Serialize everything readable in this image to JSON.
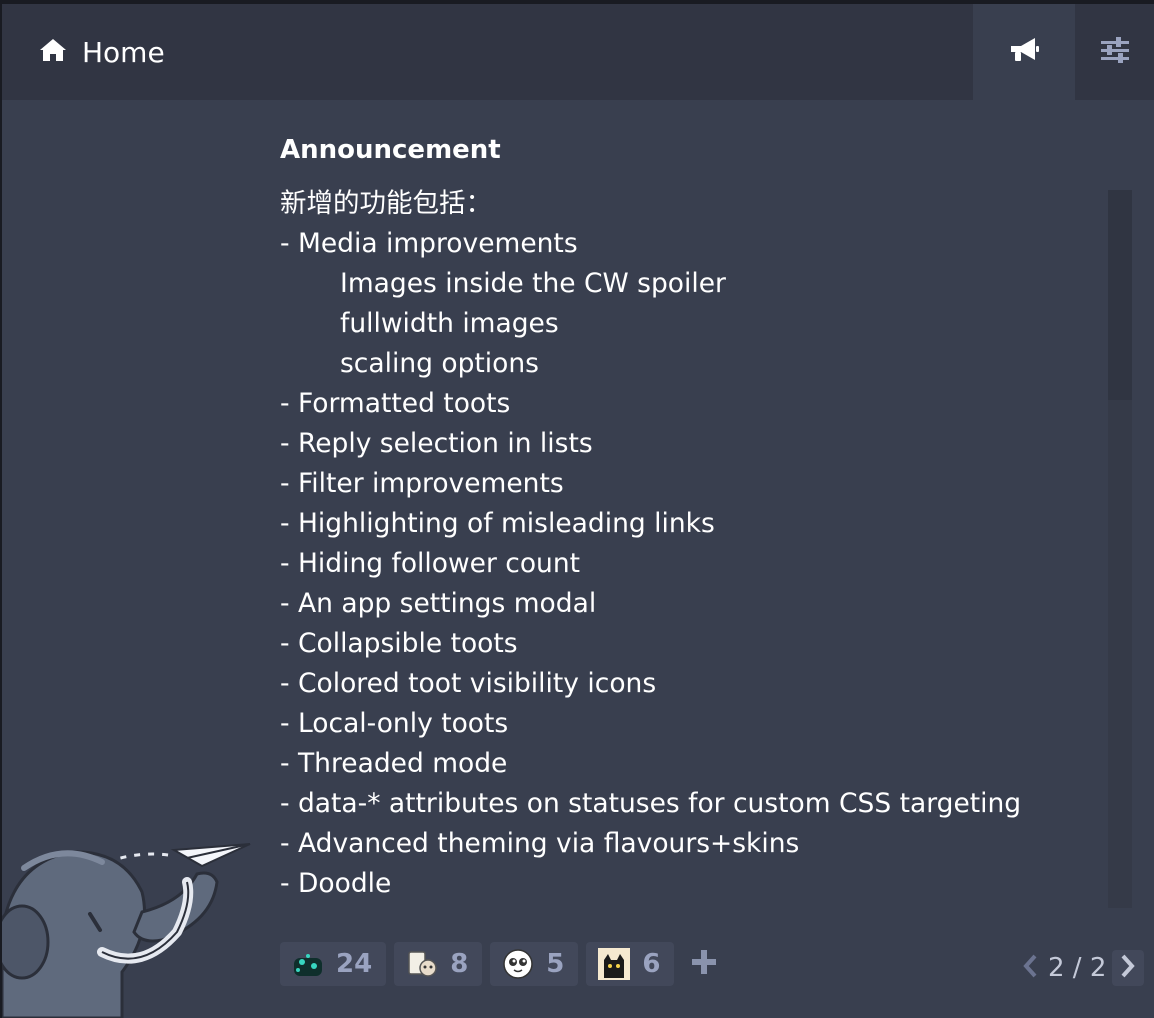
{
  "header": {
    "title": "Home",
    "icons": {
      "home": "home-icon",
      "announcements": "bullhorn-icon",
      "settings": "sliders-icon"
    }
  },
  "announcement": {
    "title": "Announcement",
    "lines": [
      {
        "text": "新增的功能包括：",
        "indent": false
      },
      {
        "text": "- Media improvements",
        "indent": false
      },
      {
        "text": "Images inside the CW spoiler",
        "indent": true
      },
      {
        "text": "fullwidth images",
        "indent": true
      },
      {
        "text": "scaling options",
        "indent": true
      },
      {
        "text": "- Formatted toots",
        "indent": false
      },
      {
        "text": "- Reply selection in lists",
        "indent": false
      },
      {
        "text": "- Filter improvements",
        "indent": false
      },
      {
        "text": "- Highlighting of misleading links",
        "indent": false
      },
      {
        "text": "- Hiding follower count",
        "indent": false
      },
      {
        "text": "- An app settings modal",
        "indent": false
      },
      {
        "text": "- Collapsible toots",
        "indent": false
      },
      {
        "text": "- Colored toot visibility icons",
        "indent": false
      },
      {
        "text": "- Local-only toots",
        "indent": false
      },
      {
        "text": "- Threaded mode",
        "indent": false
      },
      {
        "text": "- data-* attributes on statuses for custom CSS targeting",
        "indent": false
      },
      {
        "text": "- Advanced theming via flavours+skins",
        "indent": false
      },
      {
        "text": "- Doodle",
        "indent": false
      }
    ]
  },
  "reactions": [
    {
      "emoji": "teal-creature-emoji",
      "count": "24"
    },
    {
      "emoji": "paper-cat-emoji",
      "count": "8"
    },
    {
      "emoji": "round-face-emoji",
      "count": "5"
    },
    {
      "emoji": "black-cat-emoji",
      "count": "6"
    }
  ],
  "add_reaction_icon": "plus-icon",
  "pagination": {
    "text": "2 / 2"
  },
  "colors": {
    "background": "#393f4f",
    "header": "#313543",
    "reaction_bg": "#42485a",
    "count_text": "#9aa3c0"
  }
}
